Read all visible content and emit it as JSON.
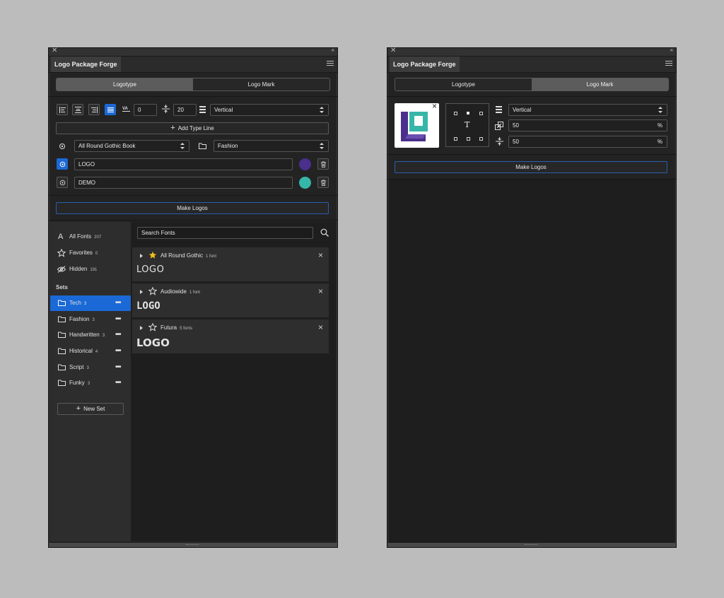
{
  "panel_title": "Logo Package Forge",
  "tabs": {
    "logotype": "Logotype",
    "logo_mark": "Logo Mark"
  },
  "left": {
    "spacing_value": "0",
    "line_height_value": "20",
    "orientation": "Vertical",
    "add_type_line": "Add Type Line",
    "font_select": "All Round Gothic Book",
    "set_select": "Fashion",
    "lines": [
      {
        "text": "LOGO",
        "color": "#4a2f8c"
      },
      {
        "text": "DEMO",
        "color": "#36b6a8"
      }
    ],
    "make_logos": "Make Logos",
    "search_placeholder": "Search Fonts",
    "filters": [
      {
        "label": "All Fonts",
        "count": "207"
      },
      {
        "label": "Favorites",
        "count": "0"
      },
      {
        "label": "Hidden",
        "count": "191"
      }
    ],
    "sets_heading": "Sets",
    "sets": [
      {
        "label": "Tech",
        "count": "3"
      },
      {
        "label": "Fashion",
        "count": "3"
      },
      {
        "label": "Handwritten",
        "count": "3"
      },
      {
        "label": "Historical",
        "count": "4"
      },
      {
        "label": "Script",
        "count": "3"
      },
      {
        "label": "Funky",
        "count": "3"
      }
    ],
    "new_set": "New Set",
    "fonts": [
      {
        "name": "All Round Gothic",
        "count": "1 font",
        "sample": "LOGO",
        "favorite": true
      },
      {
        "name": "Audiowide",
        "count": "1 font",
        "sample": "LOGO",
        "favorite": false
      },
      {
        "name": "Futura",
        "count": "5 fonts",
        "sample": "LOGO",
        "favorite": false
      }
    ]
  },
  "right": {
    "orientation": "Vertical",
    "scale_value": "50",
    "spacing_value": "50",
    "percent": "%",
    "text_glyph": "T",
    "make_logos": "Make Logos"
  },
  "colors": {
    "accent": "#1b69d6",
    "panel": "#232323",
    "star": "#f2c01d"
  }
}
